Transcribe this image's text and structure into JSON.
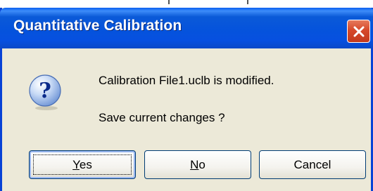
{
  "dialog": {
    "title": "Quantitative Calibration",
    "message_line1": "Calibration File1.uclb is modified.",
    "message_line2": "Save current changes ?",
    "icon": "question-icon",
    "close_icon": "close-icon"
  },
  "buttons": {
    "yes": {
      "mnemonic": "Y",
      "rest": "es"
    },
    "no": {
      "mnemonic": "N",
      "rest": "o"
    },
    "cancel": "Cancel"
  },
  "colors": {
    "titlebar": "#0553dc",
    "dialog_bg": "#ece9d8",
    "close_button": "#d6492a"
  }
}
